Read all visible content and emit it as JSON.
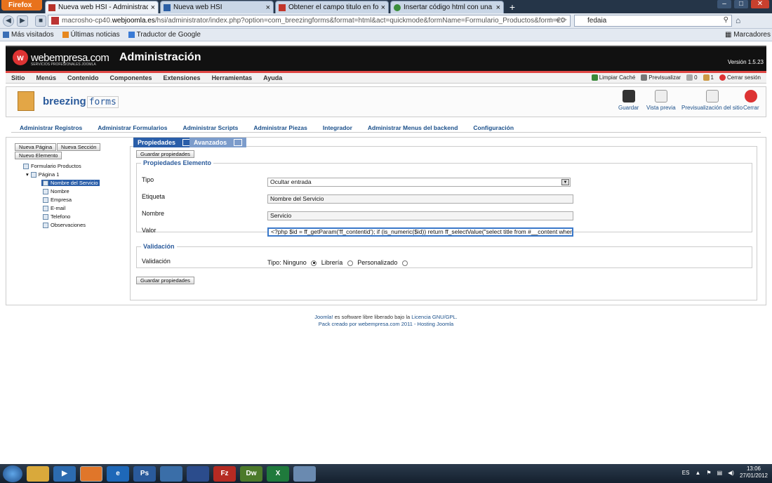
{
  "browser": {
    "menu_button": "Firefox",
    "tabs": [
      {
        "title": "Nueva web HSI - Administración",
        "active": true,
        "color": "#b8322a"
      },
      {
        "title": "Nueva web HSI",
        "active": false,
        "color": "#2c5fa5"
      },
      {
        "title": "Obtener el campo titulo en formulari...",
        "active": false,
        "color": "#c2362b"
      },
      {
        "title": "Insertar código html con una imagen...",
        "active": false,
        "color": "#3a8e3a"
      }
    ],
    "url_prefix": "macrosho-cp40.",
    "url_host": "webjoomla.es",
    "url_path": "/hsi/administrator/index.php?option=com_breezingforms&format=html&act=quickmode&formName=Formulario_Productos&form=20",
    "search_value": "fedaia",
    "bookmarks": [
      "Más visitados",
      "Últimas noticias",
      "Traductor de Google"
    ],
    "bookmarks_right": "Marcadores"
  },
  "admin": {
    "logo_text": "webempresa.com",
    "logo_sub": "SERVICIOS PROFESIONALES JOOMLA",
    "title": "Administración",
    "version": "Versión 1.5.23",
    "menu": [
      "Sitio",
      "Menús",
      "Contenido",
      "Componentes",
      "Extensiones",
      "Herramientas",
      "Ayuda"
    ],
    "menu_right": [
      "Limpiar Caché",
      "Previsualizar",
      "0",
      "1",
      "Cerrar sesión"
    ],
    "component_name": "breezing",
    "component_name2": "forms",
    "toolbar": [
      "Guardar",
      "Vista previa",
      "Previsualización del sitio",
      "Cerrar"
    ],
    "submenu": [
      "Administrar Registros",
      "Administrar Formularios",
      "Administrar Scripts",
      "Administrar Piezas",
      "Integrador",
      "Administrar Menus del backend",
      "Configuración"
    ]
  },
  "left": {
    "buttons": [
      "Nueva Página",
      "Nueva Sección",
      "Nuevo Elemento"
    ],
    "tree": {
      "form": "Formulario Productos",
      "page": "Página 1",
      "items": [
        "Nombre del Servicio",
        "Nombre",
        "Empresa",
        "E-mail",
        "Telefono",
        "Observaciones"
      ]
    }
  },
  "panel": {
    "tabs": [
      "Propiedades",
      "Avanzados"
    ],
    "save_button": "Guardar propiedades",
    "props_legend": "Propiedades Elemento",
    "fields": {
      "tipo_label": "Tipo",
      "tipo_value": "Ocultar entrada",
      "etiqueta_label": "Etiqueta",
      "etiqueta_value": "Nombre del Servicio",
      "nombre_label": "Nombre",
      "nombre_value": "Servicio",
      "valor_label": "Valor",
      "valor_value": "<?php  $id = ff_getParam('ff_contentid'); if (is_numeric($id))     return ff_selectValue(\"select title from #__content where id="
    },
    "validation_legend": "Validación",
    "validation_label": "Validación",
    "validation_type": "Tipo: Ninguno",
    "validation_opts": [
      "Librería",
      "Personalizado"
    ]
  },
  "footer": {
    "line1_a": "Joomla!",
    "line1_b": " es software libre liberado bajo la ",
    "line1_c": "Licencia GNU/GPL.",
    "line2": "Pack creado por webempresa.com 2011 - Hosting Joomla"
  },
  "taskbar": {
    "lang": "ES",
    "time": "13:06",
    "date": "27/01/2012"
  }
}
